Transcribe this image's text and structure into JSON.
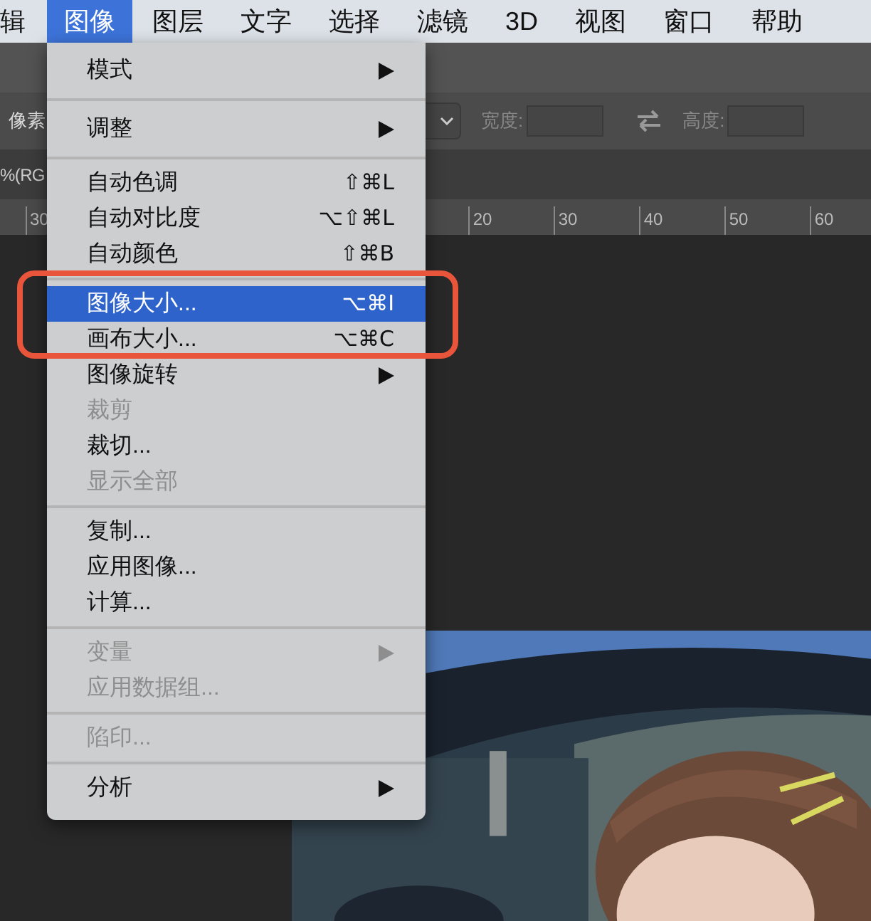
{
  "menu_bar": {
    "items": [
      {
        "label": "辑",
        "selected": false
      },
      {
        "label": "图像",
        "selected": true
      },
      {
        "label": "图层",
        "selected": false
      },
      {
        "label": "文字",
        "selected": false
      },
      {
        "label": "选择",
        "selected": false
      },
      {
        "label": "滤镜",
        "selected": false
      },
      {
        "label": "3D",
        "selected": false
      },
      {
        "label": "视图",
        "selected": false
      },
      {
        "label": "窗口",
        "selected": false
      },
      {
        "label": "帮助",
        "selected": false
      }
    ]
  },
  "options_bar": {
    "units_label": "像素",
    "width_label": "宽度:",
    "height_label": "高度:"
  },
  "document_tab": {
    "title": "%(RG"
  },
  "ruler": {
    "left_label": "30",
    "labels": [
      "20",
      "30",
      "40",
      "50",
      "60"
    ]
  },
  "menu": {
    "sections": [
      [
        {
          "label": "模式",
          "submenu": true,
          "disabled": false,
          "selected": false
        }
      ],
      [
        {
          "label": "调整",
          "submenu": true,
          "disabled": false,
          "selected": false
        }
      ],
      [
        {
          "label": "自动色调",
          "shortcut": "⇧⌘L",
          "submenu": false,
          "disabled": false,
          "selected": false
        },
        {
          "label": "自动对比度",
          "shortcut": "⌥⇧⌘L",
          "submenu": false,
          "disabled": false,
          "selected": false
        },
        {
          "label": "自动颜色",
          "shortcut": "⇧⌘B",
          "submenu": false,
          "disabled": false,
          "selected": false
        }
      ],
      [
        {
          "label": "图像大小...",
          "shortcut": "⌥⌘I",
          "submenu": false,
          "disabled": false,
          "selected": true
        },
        {
          "label": "画布大小...",
          "shortcut": "⌥⌘C",
          "submenu": false,
          "disabled": false,
          "selected": false
        },
        {
          "label": "图像旋转",
          "submenu": true,
          "disabled": false,
          "selected": false
        },
        {
          "label": "裁剪",
          "submenu": false,
          "disabled": true,
          "selected": false
        },
        {
          "label": "裁切...",
          "submenu": false,
          "disabled": false,
          "selected": false
        },
        {
          "label": "显示全部",
          "submenu": false,
          "disabled": true,
          "selected": false
        }
      ],
      [
        {
          "label": "复制...",
          "submenu": false,
          "disabled": false,
          "selected": false
        },
        {
          "label": "应用图像...",
          "submenu": false,
          "disabled": false,
          "selected": false
        },
        {
          "label": "计算...",
          "submenu": false,
          "disabled": false,
          "selected": false
        }
      ],
      [
        {
          "label": "变量",
          "submenu": true,
          "disabled": true,
          "selected": false
        },
        {
          "label": "应用数据组...",
          "submenu": false,
          "disabled": true,
          "selected": false
        }
      ],
      [
        {
          "label": "陷印...",
          "submenu": false,
          "disabled": true,
          "selected": false
        }
      ],
      [
        {
          "label": "分析",
          "submenu": true,
          "disabled": false,
          "selected": false
        }
      ]
    ]
  }
}
